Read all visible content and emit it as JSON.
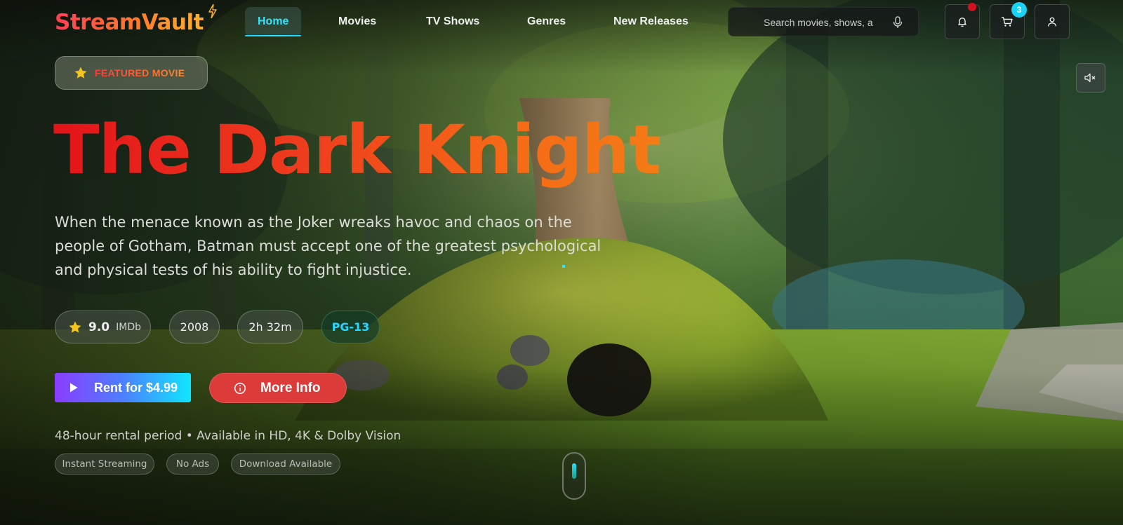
{
  "brand": {
    "name": "StreamVault",
    "accent": "#2ee6ff"
  },
  "nav": {
    "links": [
      {
        "label": "Home",
        "active": true
      },
      {
        "label": "Movies",
        "active": false
      },
      {
        "label": "TV Shows",
        "active": false
      },
      {
        "label": "Genres",
        "active": false
      },
      {
        "label": "New Releases",
        "active": false
      }
    ],
    "search_placeholder": "Search movies, shows, a",
    "cart_count": "3",
    "icons": [
      "bell-icon",
      "cart-icon",
      "user-icon",
      "mic-icon",
      "volume-mute-icon"
    ]
  },
  "hero": {
    "badge": "FEATURED MOVIE",
    "title": "The Dark Knight",
    "description": "When the menace known as the Joker wreaks havoc and chaos on the people of Gotham, Batman must accept one of the greatest psychological and physical tests of his ability to fight injustice.",
    "rating": {
      "value": "9.0",
      "source": "IMDb"
    },
    "year": "2008",
    "runtime": "2h 32m",
    "certificate": "PG-13",
    "rent_button": "Rent for $4.99",
    "info_button": "More Info",
    "rental_info": "48-hour rental period • Available in HD, 4K & Dolby Vision",
    "tags": [
      "Instant Streaming",
      "No Ads",
      "Download Available"
    ]
  },
  "colors": {
    "title_gradient": [
      "#e3131a",
      "#f47b16"
    ],
    "rent_gradient": [
      "#8a3cff",
      "#0fe6ff"
    ],
    "info_button": "#dd3a3a",
    "notification_dot": "#d3101e",
    "certificate_text": "#26d8ff"
  }
}
